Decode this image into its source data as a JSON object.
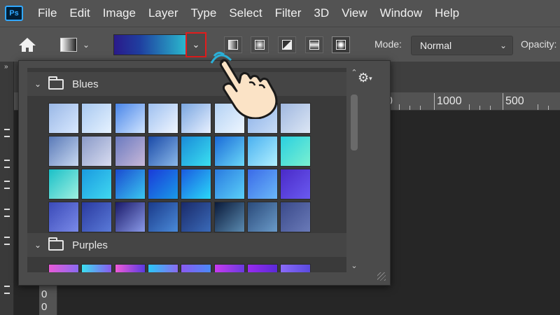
{
  "app": {
    "logo": "Ps"
  },
  "menu": [
    "File",
    "Edit",
    "Image",
    "Layer",
    "Type",
    "Select",
    "Filter",
    "3D",
    "View",
    "Window",
    "Help"
  ],
  "options_bar": {
    "mode_label": "Mode:",
    "mode_value": "Normal",
    "opacity_label": "Opacity:",
    "gradient_types": [
      "linear",
      "radial",
      "angle",
      "reflected",
      "diamond"
    ],
    "active_gradient_type": "diamond"
  },
  "rulers": {
    "top_labels": [
      "0",
      "1000",
      "500"
    ],
    "left_labels": [
      "0",
      "0"
    ]
  },
  "gradient_picker": {
    "folders": [
      {
        "name": "Blues",
        "rows": [
          [
            "#9ab8e6,#d8e8ff",
            "#a8c8f0,#e6f2ff",
            "#4a86e8,#d0e4ff",
            "#9ec0f0,#f0f6ff",
            "#7aa6e0,#e8f0ff",
            "#b4d2f4,#eef6ff",
            "#8ab0e8,#c8dcf6",
            "#a0b8e0,#dce6f4"
          ],
          [
            "#5a7ab8,#c8d8f0",
            "#8a9ac8,#d8dcf0",
            "#6a7ac0,#c8b8d8",
            "#1a4aa8,#8ab8e8",
            "#1a8ad8,#3ae0f0",
            "#1a6ad8,#6ad8f8",
            "#4ab0f0,#b0f0ff",
            "#2ad0e0,#7af0d0"
          ],
          [
            "#1ac0c8,#a0f0e0",
            "#1a9ae0,#40d8f0",
            "#1a4ad0,#3ac8f0",
            "#1a3ad8,#1a9ae8",
            "#1a5ae0,#2ad8f8",
            "#2a7ae0,#5ad0f8",
            "#3a6ae8,#6ab8f8",
            "#4a2ac8,#6a5af0"
          ],
          [
            "#3a4ab8,#7a8ae8",
            "#2a3aa0,#5a7ad8",
            "#1a1a6a,#8a9ae8",
            "#1a3a8a,#4a8ad8",
            "#1a2a6a,#3a6ab8",
            "#0a1a3a,#5a8ab0",
            "#2a4a7a,#6a9ac8",
            "#3a4a8a,#6a7ab8"
          ]
        ]
      },
      {
        "name": "Purples",
        "rows": [
          [
            "#e85ad8,#8a6af0",
            "#3ae0f0,#8a5af0",
            "#f05ad8,#5a3ae0",
            "#2ac8f8,#8a6af0",
            "#8a5af0,#4a8af8",
            "#c83af0,#6a3ae0",
            "#9a2af0,#5a2ad8",
            "#8a6af8,#5a4ae0"
          ]
        ]
      }
    ]
  },
  "colors": {
    "highlight_border": "#e21d1d",
    "menu_bg": "#535353",
    "panel_bg": "#4b4b4b",
    "canvas_bg": "#262626"
  }
}
